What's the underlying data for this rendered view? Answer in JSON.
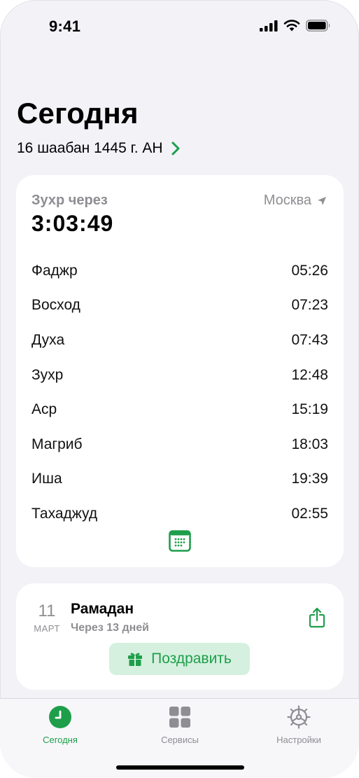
{
  "status": {
    "time": "9:41"
  },
  "header": {
    "title": "Сегодня",
    "hijri_date": "16 шаабан 1445 г. АН"
  },
  "prayer_card": {
    "next_label": "Зухр через",
    "countdown": "3:03:49",
    "city": "Москва",
    "prayers": [
      {
        "name": "Фаджр",
        "time": "05:26"
      },
      {
        "name": "Восход",
        "time": "07:23"
      },
      {
        "name": "Духа",
        "time": "07:43"
      },
      {
        "name": "Зухр",
        "time": "12:48"
      },
      {
        "name": "Аср",
        "time": "15:19"
      },
      {
        "name": "Магриб",
        "time": "18:03"
      },
      {
        "name": "Иша",
        "time": "19:39"
      },
      {
        "name": "Тахаджуд",
        "time": "02:55"
      }
    ]
  },
  "holiday_card": {
    "day": "11",
    "month": "МАРТ",
    "name": "Рамадан",
    "subtitle": "Через 13 дней",
    "congrats_label": "Поздравить"
  },
  "tabs": [
    {
      "label": "Сегодня",
      "icon": "clock-icon",
      "active": true
    },
    {
      "label": "Сервисы",
      "icon": "grid-icon",
      "active": false
    },
    {
      "label": "Настройки",
      "icon": "gear-icon",
      "active": false
    }
  ],
  "colors": {
    "accent": "#1e9e4a",
    "background": "#f2f2f7",
    "card": "#ffffff",
    "secondary_text": "#8e8e93"
  }
}
